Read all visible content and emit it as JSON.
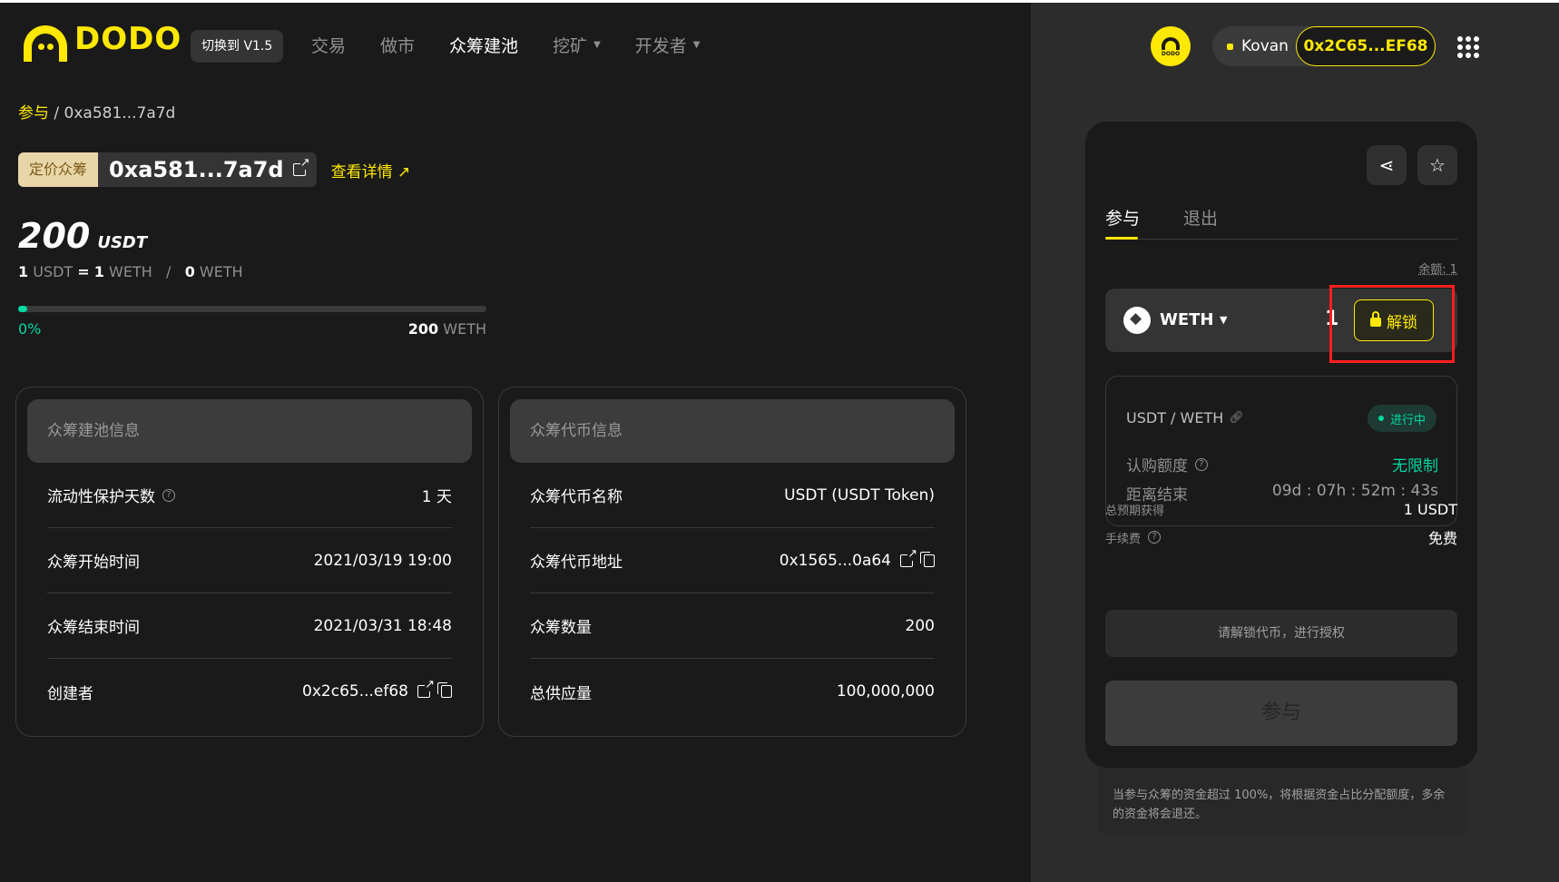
{
  "header": {
    "logo_text": "DODO",
    "version_label": "切换到 V1.5",
    "nav": [
      {
        "label": "交易",
        "active": false,
        "dropdown": false
      },
      {
        "label": "做市",
        "active": false,
        "dropdown": false
      },
      {
        "label": "众筹建池",
        "active": true,
        "dropdown": false
      },
      {
        "label": "挖矿",
        "active": false,
        "dropdown": true
      },
      {
        "label": "开发者",
        "active": false,
        "dropdown": true
      }
    ],
    "avatar_label": "DODO",
    "network": "Kovan",
    "wallet_address": "0x2C65...EF68"
  },
  "breadcrumb": {
    "parent": "参与",
    "separator": "/",
    "current": "0xa581...7a7d"
  },
  "title": {
    "tag": "定价众筹",
    "address": "0xa581...7a7d",
    "view_detail": "查看详情 ↗"
  },
  "summary": {
    "amount": "200",
    "unit": "USDT",
    "rate_lhs_num": "1",
    "rate_lhs_unit": "USDT",
    "rate_eq": "=",
    "rate_rhs_num": "1",
    "rate_rhs_unit": "WETH",
    "rate_sep": "/",
    "raised_num": "0",
    "raised_unit": "WETH"
  },
  "progress": {
    "percent": 0.02,
    "left_label": "0%",
    "right_num": "200",
    "right_unit": "WETH"
  },
  "pool_info": {
    "title": "众筹建池信息",
    "rows": [
      {
        "label": "流动性保护天数",
        "value": "1 天"
      },
      {
        "label": "众筹开始时间",
        "value": "2021/03/19 19:00"
      },
      {
        "label": "众筹结束时间",
        "value": "2021/03/31 18:48"
      },
      {
        "label": "创建者",
        "value": "0x2c65...ef68"
      }
    ]
  },
  "token_info": {
    "title": "众筹代币信息",
    "rows": [
      {
        "label": "众筹代币名称",
        "value": "USDT (USDT Token)"
      },
      {
        "label": "众筹代币地址",
        "value": "0x1565...0a64"
      },
      {
        "label": "众筹数量",
        "value": "200"
      },
      {
        "label": "总供应量",
        "value": "100,000,000"
      }
    ]
  },
  "panel": {
    "tabs": [
      "参与",
      "退出"
    ],
    "balance": "余额: 1",
    "token": "WETH",
    "amount": "1",
    "unlock_label": "解锁",
    "pair": "USDT / WETH",
    "status": "进行中",
    "quota_label": "认购额度",
    "quota_value": "无限制",
    "end_label": "距离结束",
    "end_value": "09d : 07h : 52m : 43s",
    "expected_label": "总预期获得",
    "expected_value": "1 USDT",
    "fee_label": "手续费",
    "fee_value": "免费",
    "hint": "请解锁代币，进行授权",
    "join_label": "参与",
    "note": "当参与众筹的资金超过 100%，将根据资金占比分配额度，多余的资金将会退还。"
  },
  "colors": {
    "accent": "#ffe804",
    "success": "#00d9a3",
    "highlight": "#ff1f1f"
  }
}
